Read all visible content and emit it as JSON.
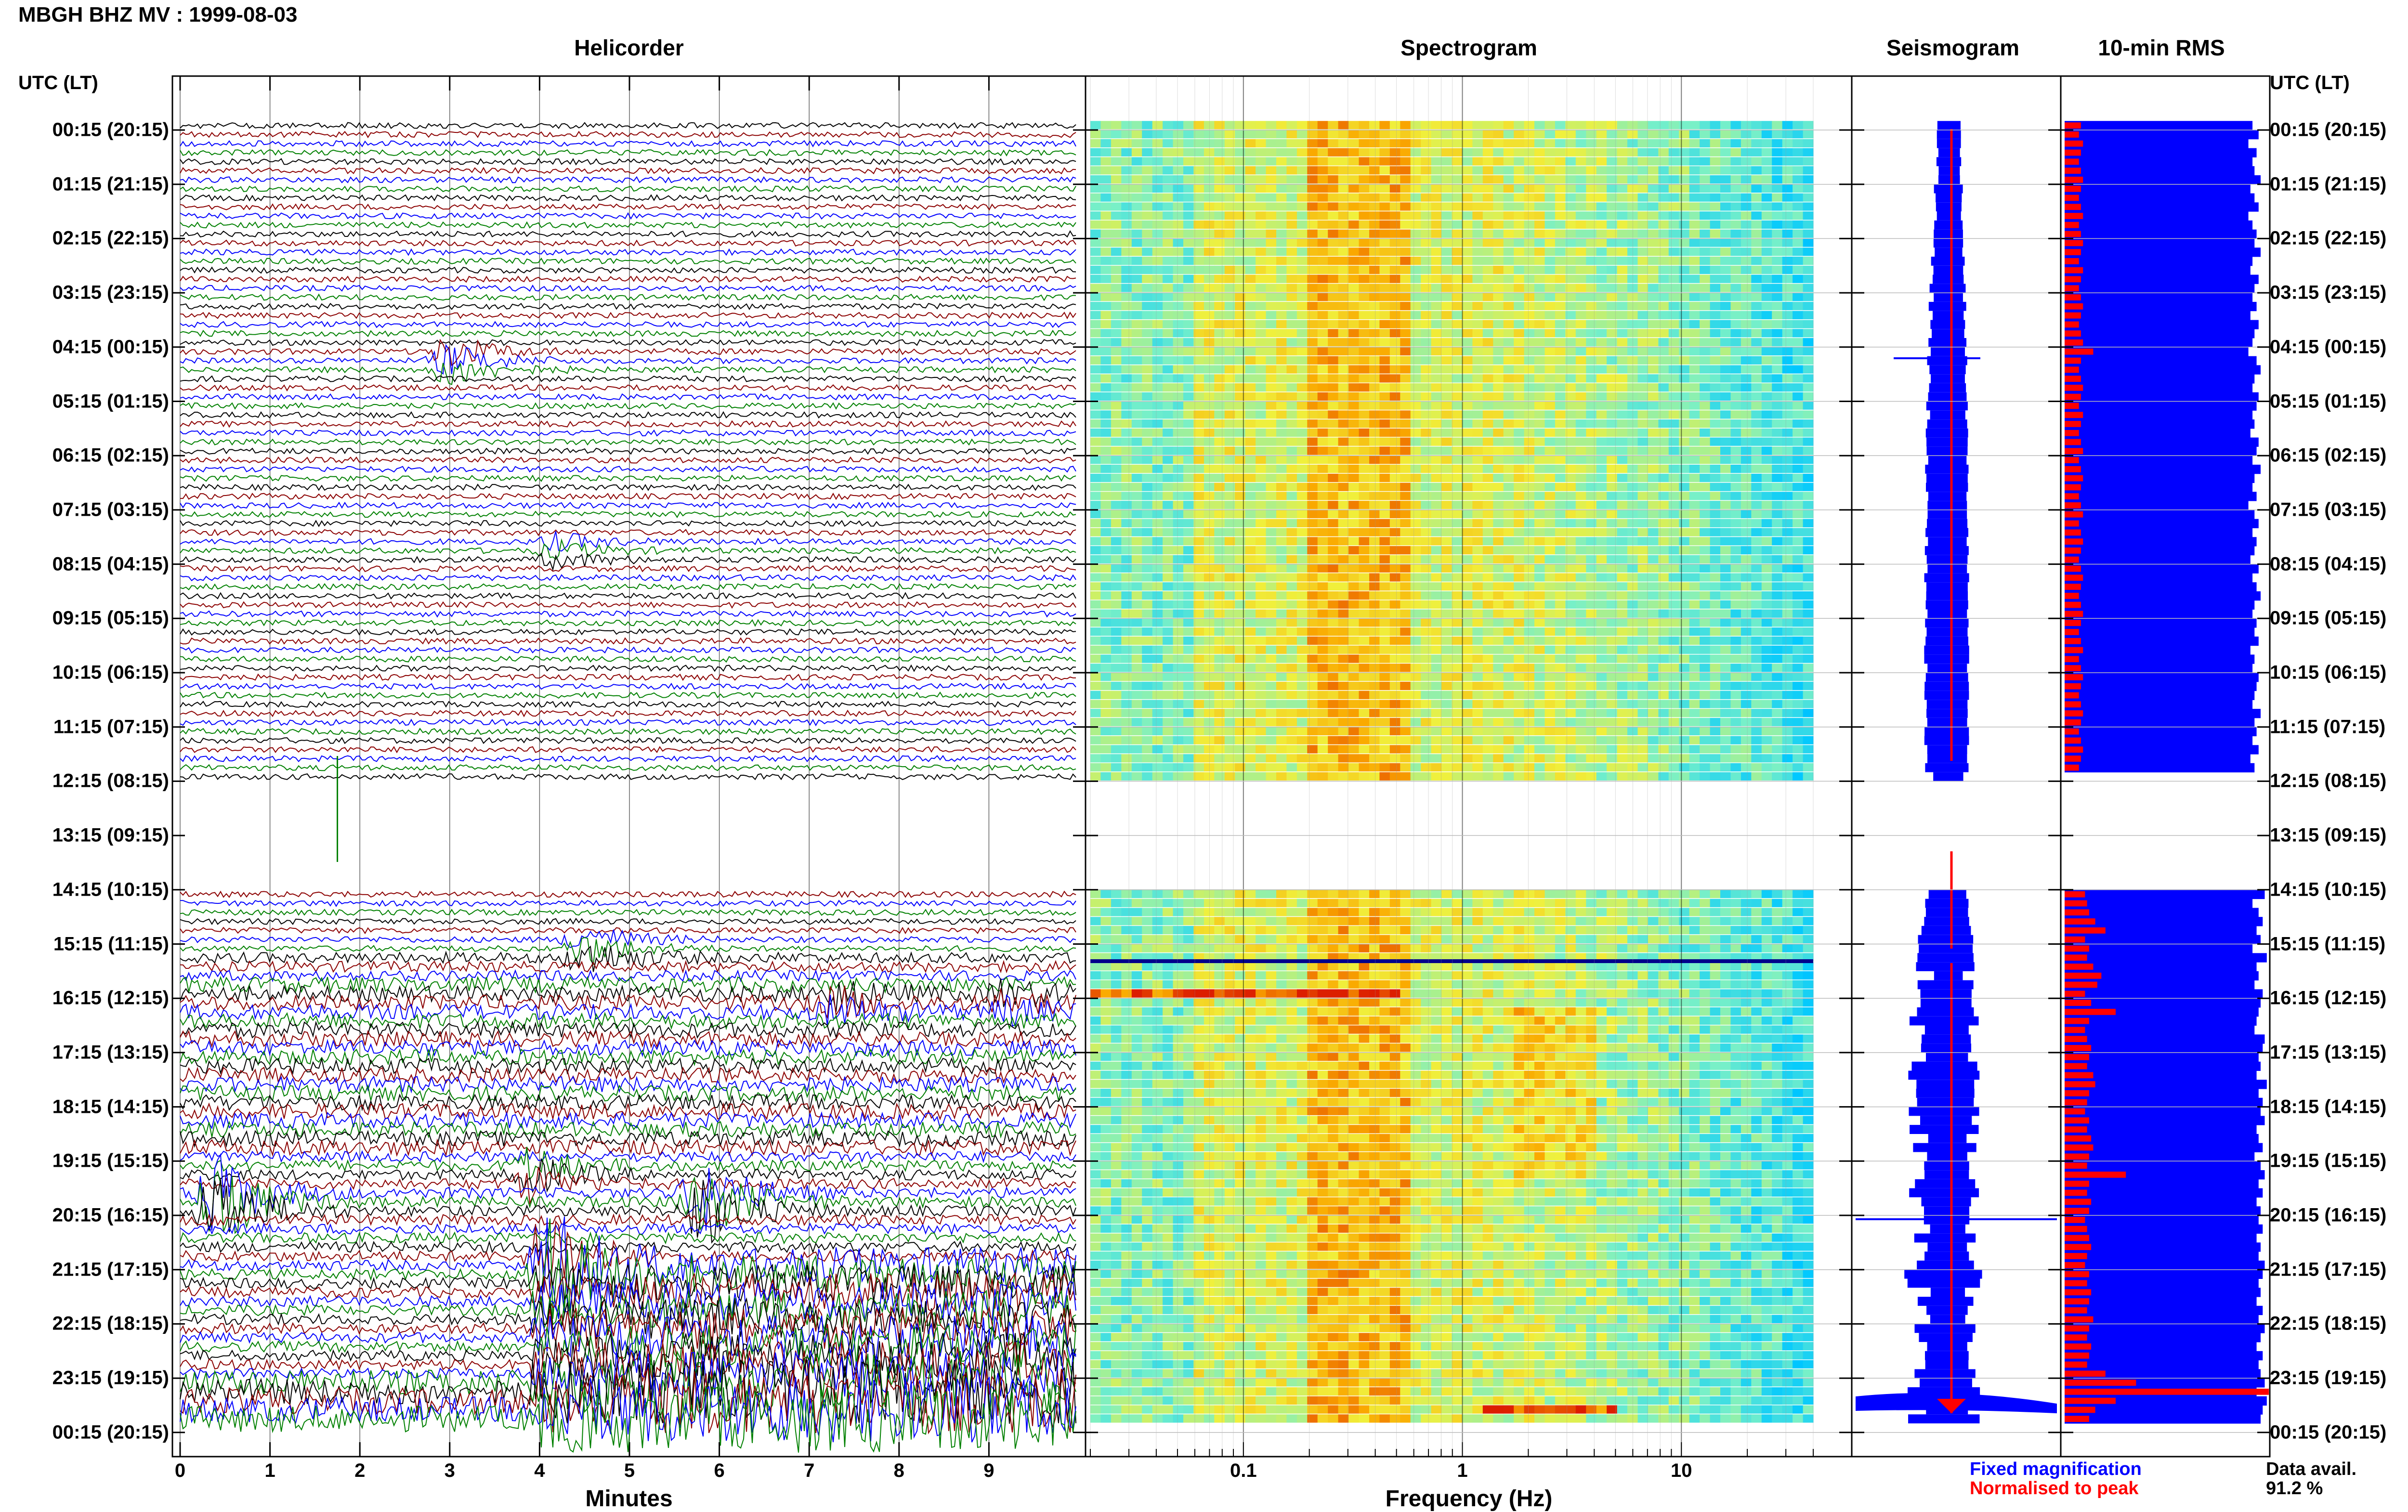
{
  "header": {
    "station_title": "MBGH BHZ MV : 1999-08-03"
  },
  "panels": {
    "helicorder": "Helicorder",
    "spectrogram": "Spectrogram",
    "seismogram": "Seismogram",
    "rms": "10-min RMS"
  },
  "axis": {
    "utc_label_left": "UTC (LT)",
    "utc_label_right": "UTC (LT)",
    "time_ticks": [
      "00:15 (20:15)",
      "01:15 (21:15)",
      "02:15 (22:15)",
      "03:15 (23:15)",
      "04:15 (00:15)",
      "05:15 (01:15)",
      "06:15 (02:15)",
      "07:15 (03:15)",
      "08:15 (04:15)",
      "09:15 (05:15)",
      "10:15 (06:15)",
      "11:15 (07:15)",
      "12:15 (08:15)",
      "13:15 (09:15)",
      "14:15 (10:15)",
      "15:15 (11:15)",
      "16:15 (12:15)",
      "17:15 (13:15)",
      "18:15 (14:15)",
      "19:15 (15:15)",
      "20:15 (16:15)",
      "21:15 (17:15)",
      "22:15 (18:15)",
      "23:15 (19:15)",
      "00:15 (20:15)"
    ],
    "minutes_ticks": [
      "0",
      "1",
      "2",
      "3",
      "4",
      "5",
      "6",
      "7",
      "8",
      "9"
    ],
    "minutes_label": "Minutes",
    "freq_ticks": [
      "0.1",
      "1",
      "10"
    ],
    "freq_label": "Frequency (Hz)"
  },
  "legend": {
    "fixed": "Fixed magnification",
    "normalised": "Normalised to peak",
    "fixed_color": "#0000ff",
    "normalised_color": "#ff0000"
  },
  "availability": {
    "label": "Data avail.",
    "value": "91.2 %"
  },
  "chart_data": {
    "type": "heatmap",
    "trace_colors": [
      "#000000",
      "#8b0000",
      "#0000ff",
      "#008000"
    ],
    "rows_per_hour": 6,
    "hours": 24,
    "minutes_per_row": 10,
    "data_gap_hours": [
      12,
      13
    ],
    "helicorder_events": [
      {
        "time": "04:15",
        "minute": 3.0,
        "amplitude": 1.5,
        "color": "#8b0000"
      },
      {
        "time": "07:45",
        "minute": 4.2,
        "amplitude": 0.8,
        "color": "#8b0000"
      },
      {
        "time": "15:05",
        "minute": 4.5,
        "amplitude": 1.6,
        "color": "#0000ff"
      },
      {
        "time": "16:05",
        "minute": 7.3,
        "amplitude": 1.2,
        "color": "#008000"
      },
      {
        "time": "16:05",
        "minute": 9.2,
        "amplitude": 1.0,
        "color": "#8b0000"
      },
      {
        "time": "19:45",
        "minute": 0.4,
        "amplitude": 4.0,
        "color": "#8b0000"
      },
      {
        "time": "19:45",
        "minute": 5.8,
        "amplitude": 3.5,
        "color": "#8b0000"
      },
      {
        "time": "19:15",
        "minute": 3.9,
        "amplitude": 1.6,
        "color": "#008000"
      },
      {
        "time": "21:00",
        "minute": 4.1,
        "amplitude": 5.0,
        "color": "#000000"
      }
    ],
    "spectrogram_freq_range_hz": [
      0.02,
      40
    ],
    "seismogram_envelope": {
      "type": "bar",
      "note_color_fixed": "#0000ff",
      "note_color_norm": "#ff0000"
    },
    "rms_10min": {
      "fixed_magnification": [
        0.92,
        0.95,
        0.9,
        0.94,
        0.92,
        0.93,
        0.96,
        0.91,
        0.93,
        0.95,
        0.9,
        0.92,
        0.94,
        0.93,
        0.96,
        0.92,
        0.91,
        0.95,
        0.93,
        0.92,
        0.94,
        0.91,
        0.95,
        0.93,
        0.92,
        0.9,
        0.94,
        0.96,
        0.93,
        0.92,
        0.95,
        0.94,
        0.92,
        0.93,
        0.91,
        0.95,
        0.94,
        0.92,
        0.96,
        0.93,
        0.92,
        0.94,
        0.9,
        0.93,
        0.95,
        0.92,
        0.94,
        0.93,
        0.91,
        0.95,
        0.92,
        0.94,
        0.96,
        0.93,
        0.92,
        0.94,
        0.93,
        0.95,
        0.91,
        0.93,
        0.92,
        0.95,
        0.94,
        0.93,
        0.92,
        0.96,
        0.93,
        0.94,
        0.92,
        0.95,
        0.91,
        0.93,
        0,
        0,
        0,
        0,
        0,
        0,
        0,
        0,
        0,
        0,
        0,
        0,
        0.94,
        0.98,
        0.92,
        0.95,
        0.97,
        0.94,
        0.96,
        0.92,
        0.99,
        0.94,
        0.95,
        0.93,
        0.97,
        0.96,
        0.95,
        0.94,
        0.93,
        0.98,
        0.97,
        0.95,
        0.96,
        0.94,
        0.99,
        0.95,
        0.97,
        0.96,
        0.98,
        0.94,
        0.95,
        0.97,
        0.93,
        0.96,
        0.98,
        0.95,
        0.97,
        0.94,
        0.96,
        0.95,
        0.97,
        0.94,
        0.96,
        0.95,
        0.98,
        0.97,
        0.95,
        0.96,
        0.94,
        0.97,
        0.95,
        0.98,
        0.96,
        0.94,
        0.97,
        0.95,
        0.96,
        0.98,
        0.94,
        0.99,
        0.97,
        0.96,
        0.95,
        0.98,
        0.97,
        0.96
      ],
      "normalised_to_peak": [
        0.08,
        0.07,
        0.09,
        0.08,
        0.07,
        0.08,
        0.09,
        0.08,
        0.07,
        0.08,
        0.09,
        0.07,
        0.08,
        0.09,
        0.08,
        0.07,
        0.09,
        0.08,
        0.07,
        0.08,
        0.09,
        0.08,
        0.07,
        0.08,
        0.09,
        0.14,
        0.08,
        0.07,
        0.08,
        0.09,
        0.08,
        0.07,
        0.09,
        0.08,
        0.07,
        0.08,
        0.09,
        0.07,
        0.08,
        0.09,
        0.08,
        0.07,
        0.08,
        0.09,
        0.07,
        0.08,
        0.09,
        0.08,
        0.07,
        0.08,
        0.09,
        0.08,
        0.07,
        0.08,
        0.09,
        0.08,
        0.07,
        0.08,
        0.09,
        0.07,
        0.08,
        0.09,
        0.08,
        0.07,
        0.08,
        0.09,
        0.08,
        0.07,
        0.08,
        0.09,
        0.08,
        0.07,
        0,
        0,
        0,
        0,
        0,
        0,
        0,
        0,
        0,
        0,
        0,
        0,
        0.09,
        0.1,
        0.11,
        0.12,
        0.15,
        0.2,
        0.1,
        0.12,
        0.11,
        0.14,
        0.18,
        0.16,
        0.1,
        0.13,
        0.25,
        0.12,
        0.1,
        0.11,
        0.13,
        0.12,
        0.11,
        0.14,
        0.15,
        0.12,
        0.11,
        0.1,
        0.12,
        0.11,
        0.13,
        0.14,
        0.12,
        0.11,
        0.3,
        0.12,
        0.11,
        0.13,
        0.12,
        0.1,
        0.11,
        0.12,
        0.13,
        0.11,
        0.1,
        0.12,
        0.11,
        0.13,
        0.12,
        0.11,
        0.14,
        0.12,
        0.11,
        0.13,
        0.12,
        0.11,
        0.2,
        0.35,
        1.0,
        0.25,
        0.15,
        0.12,
        0.1,
        0.09,
        0.08,
        0.07
      ]
    }
  }
}
